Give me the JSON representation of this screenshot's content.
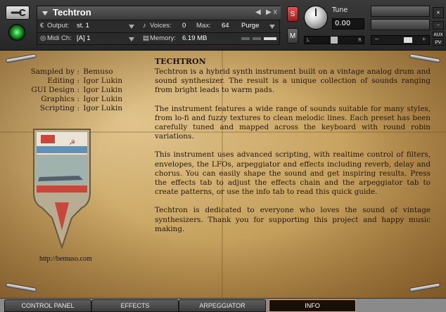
{
  "header": {
    "instrument_name": "Techtron",
    "output_label": "Output:",
    "output_value": "st. 1",
    "voices_label": "Voices:",
    "voices_value": "0",
    "max_label": "Max:",
    "max_value": "64",
    "purge_label": "Purge",
    "midi_label": "Midi Ch:",
    "midi_value": "[A]  1",
    "memory_label": "Memory:",
    "memory_value": "6.19 MB",
    "close_label": "x",
    "solo_label": "S",
    "mute_label": "M",
    "tune_label": "Tune",
    "tune_value": "0.00",
    "pan_left": "L",
    "pan_right": "R",
    "aux_label": "AUX",
    "pv_label": "PV",
    "icons": {
      "wrench": "wrench-icon",
      "power": "power-led-icon",
      "dropdown": "chevron-down-icon",
      "prev": "chevron-left-icon",
      "next": "chevron-right-icon",
      "camera": "camera-icon",
      "info": "info-icon"
    },
    "colors": {
      "solo": "#d13b3b",
      "power_led": "#22c43a"
    }
  },
  "credits": [
    {
      "label": "Sampled by",
      "value": "Bemuso"
    },
    {
      "label": "Editing",
      "value": "Igor Lukin"
    },
    {
      "label": "GUI Design",
      "value": "Igor Lukin"
    },
    {
      "label": "Graphics",
      "value": "Igor Lukin"
    },
    {
      "label": "Scripting",
      "value": "Igor Lukin"
    }
  ],
  "site_url": "http://bemuso.com",
  "info": {
    "title": "TECHTRON",
    "paragraphs": [
      "Techtron is a hybrid synth instrument built on a vintage analog drum and sound synthesizer. The result is a unique collection of sounds ranging from bright leads to warm pads.",
      "The instrument features a wide range of sounds suitable for many styles, from lo-fi and fuzzy textures to clean melodic lines. Each preset has been carefully tuned and mapped across the keyboard with round robin variations.",
      "This instrument uses advanced scripting, with realtime control of filters, envelopes, the LFOs, arpeggiator and effects including reverb, delay and chorus. You can easily shape the sound and get inspiring results. Press the effects tab to adjust the effects chain and the arpeggiator tab to create patterns, or use the info tab to read this quick guide.",
      "Techtron is dedicated to everyone who loves the sound of vintage synthesizers. Thank you for supporting this project and happy music making."
    ]
  },
  "tabs": [
    {
      "label": "CONTROL PANEL",
      "active": false
    },
    {
      "label": "EFFECTS",
      "active": false
    },
    {
      "label": "ARPEGGIATOR",
      "active": false
    },
    {
      "label": "INFO",
      "active": true
    }
  ]
}
